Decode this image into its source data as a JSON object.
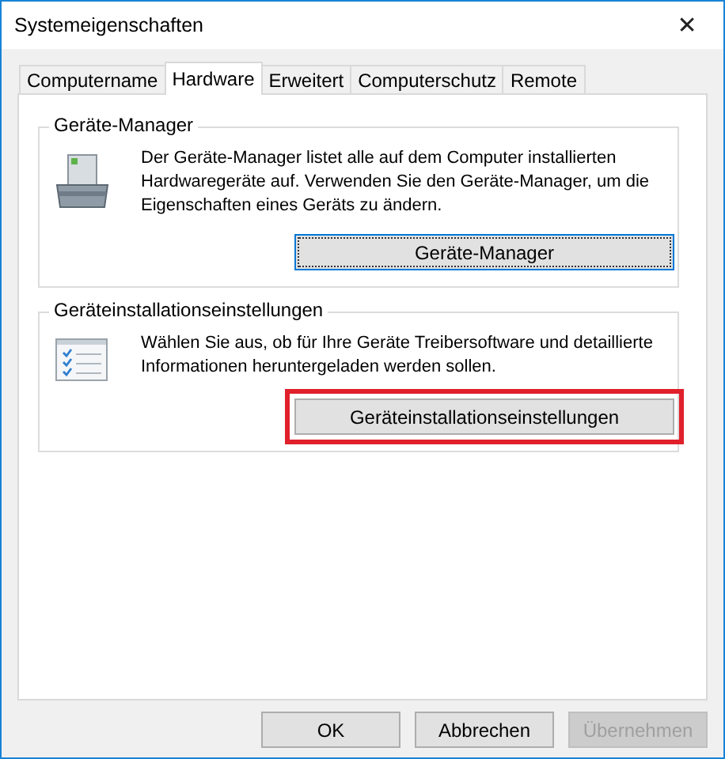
{
  "window": {
    "title": "Systemeigenschaften",
    "close": "✕"
  },
  "tabs": [
    {
      "label": "Computername",
      "selected": false
    },
    {
      "label": "Hardware",
      "selected": true
    },
    {
      "label": "Erweitert",
      "selected": false
    },
    {
      "label": "Computerschutz",
      "selected": false
    },
    {
      "label": "Remote",
      "selected": false
    }
  ],
  "groups": [
    {
      "title": "Geräte-Manager",
      "kind": "device-manager",
      "text": "Der Geräte-Manager listet alle auf dem Computer installierten Hardwaregeräte auf. Verwenden Sie den Geräte-Manager, um die Eigenschaften eines Geräts zu ändern.",
      "button": {
        "label": "Geräte-Manager",
        "focused": true,
        "highlighted": false
      }
    },
    {
      "title": "Geräteinstallationseinstellungen",
      "kind": "checklist",
      "text": "Wählen Sie aus, ob für Ihre Geräte Treibersoftware und detaillierte Informationen heruntergeladen werden sollen.",
      "button": {
        "label": "Geräteinstallationseinstellungen",
        "focused": false,
        "highlighted": true
      }
    }
  ],
  "buttons": [
    {
      "label": "OK",
      "disabled": false
    },
    {
      "label": "Abbrechen",
      "disabled": false
    },
    {
      "label": "Übernehmen",
      "disabled": true
    }
  ]
}
